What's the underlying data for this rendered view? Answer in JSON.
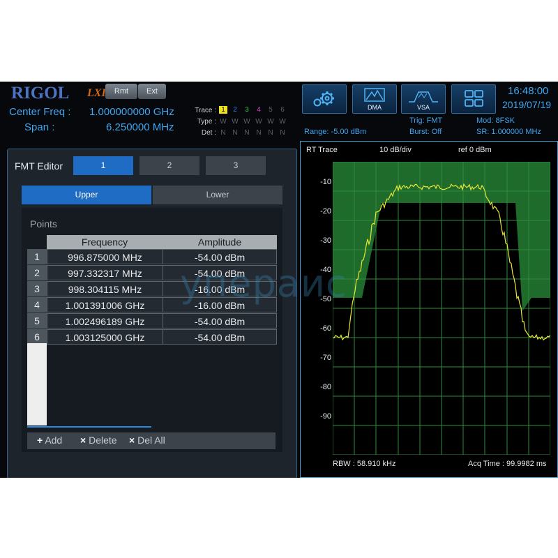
{
  "header": {
    "logo": "RIGOL",
    "lxi": "LXI",
    "rmt_label": "Rmt",
    "ext_label": "Ext",
    "center_freq_label": "Center Freq :",
    "center_freq_value": "1.000000000 GHz",
    "span_label": "Span :",
    "span_value": "6.250000 MHz",
    "trace_label": "Trace :",
    "type_label": "Type :",
    "det_label": "Det :",
    "trace_numbers": [
      "1",
      "2",
      "3",
      "4",
      "5",
      "6"
    ],
    "type_values": [
      "W",
      "W",
      "W",
      "W",
      "W",
      "W"
    ],
    "det_values": [
      "N",
      "N",
      "N",
      "N",
      "N",
      "N"
    ],
    "icons": [
      {
        "name": "settings-gear-icon",
        "label": ""
      },
      {
        "name": "dma-icon",
        "label": "DMA"
      },
      {
        "name": "vsa-icon",
        "label": "VSA"
      },
      {
        "name": "window-layout-icon",
        "label": ""
      }
    ],
    "clock_time": "16:48:00",
    "clock_date": "2019/07/19",
    "range": "Range: -5.00 dBm",
    "trig": "Trig: FMT",
    "burst": "Burst: Off",
    "mod": "Mod: 8FSK",
    "sr": "SR: 1.000000 MHz"
  },
  "fmt_editor": {
    "title": "FMT Editor",
    "tabs": [
      "1",
      "2",
      "3"
    ],
    "active_tab": "1",
    "sub_tabs": [
      "Upper",
      "Lower"
    ],
    "active_sub_tab": "Upper",
    "points_title": "Points",
    "columns": [
      "Frequency",
      "Amplitude"
    ],
    "rows": [
      {
        "n": "1",
        "frequency": "996.875000 MHz",
        "amplitude": "-54.00 dBm"
      },
      {
        "n": "2",
        "frequency": "997.332317 MHz",
        "amplitude": "-54.00 dBm"
      },
      {
        "n": "3",
        "frequency": "998.304115 MHz",
        "amplitude": "-16.00 dBm"
      },
      {
        "n": "4",
        "frequency": "1.001391006 GHz",
        "amplitude": "-16.00 dBm"
      },
      {
        "n": "5",
        "frequency": "1.002496189 GHz",
        "amplitude": "-54.00 dBm"
      },
      {
        "n": "6",
        "frequency": "1.003125000 GHz",
        "amplitude": "-54.00 dBm"
      }
    ],
    "buttons": {
      "add": "Add",
      "delete": "Delete",
      "del_all": "Del All"
    }
  },
  "trace": {
    "title": "RT Trace",
    "scale": "10 dB/div",
    "ref": "ref 0 dBm",
    "rbw": "RBW : 58.910 kHz",
    "acq": "Acq Time : 99.9982 ms",
    "y_ticks": [
      "-10",
      "-20",
      "-30",
      "-40",
      "-50",
      "-60",
      "-70",
      "-80",
      "-90"
    ]
  },
  "colors": {
    "accent": "#3ea7f0",
    "mask_green": "#1f6b2c",
    "trace_yellow": "#e8e838",
    "grid": "#2f8c3a"
  },
  "watermark": "упераис"
}
